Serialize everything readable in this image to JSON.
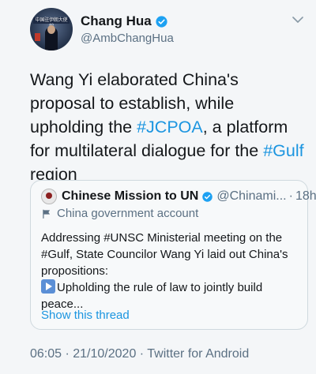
{
  "author": {
    "name": "Chang Hua",
    "handle": "@AmbChangHua",
    "avatar_banner": "中国驻伊朗大使馆"
  },
  "tweet": {
    "text_1": "Wang Yi elaborated China's proposal to establish, while upholding the ",
    "hashtag_1": "#JCPOA",
    "text_2": ", a platform for multilateral dialogue for the ",
    "hashtag_2": "#Gulf",
    "text_3": " region"
  },
  "quoted": {
    "name": "Chinese Mission to UN",
    "handle": "@Chinami...",
    "separator": "·",
    "time": "18h",
    "label": "China government account",
    "text_1": "Addressing #UNSC Ministerial meeting on the #Gulf, State Councilor Wang Yi laid out China's propositions:",
    "text_2": "Upholding the rule of law to jointly build peace...",
    "show_thread": "Show this thread"
  },
  "footer": {
    "meta": "06:05 · 21/10/2020 · Twitter for Android"
  },
  "icons": {
    "more": "chevron-down-icon",
    "verified": "verified-badge-icon",
    "label": "flag-icon",
    "emoji": "play-button-emoji"
  },
  "colors": {
    "link": "#1b95e0",
    "muted": "#5b7083",
    "verified": "#1da1f2"
  }
}
